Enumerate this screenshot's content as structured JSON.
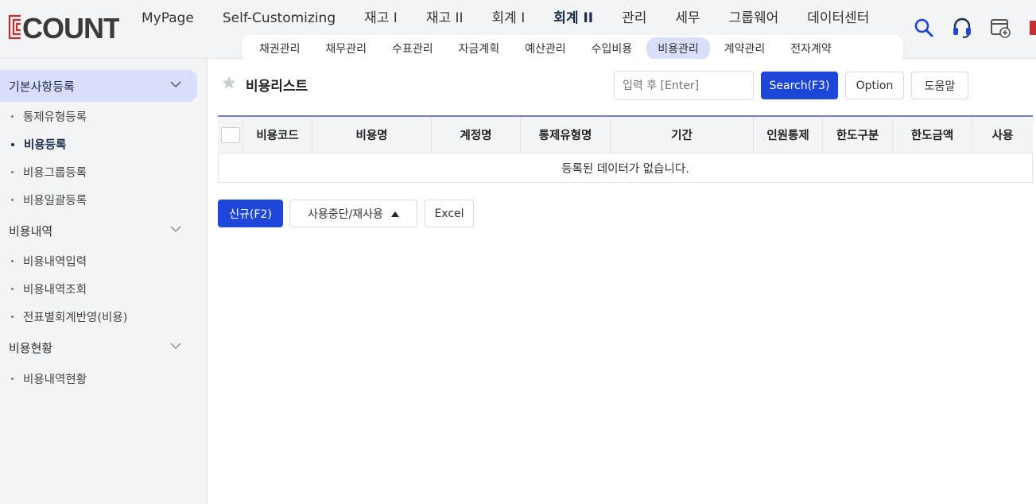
{
  "brand": {
    "logo_text": "ECOUNT",
    "logo_color": "#c62d2d"
  },
  "main_nav": [
    {
      "label": "MyPage",
      "active": false
    },
    {
      "label": "Self-Customizing",
      "active": false
    },
    {
      "label": "재고 I",
      "active": false
    },
    {
      "label": "재고 II",
      "active": false
    },
    {
      "label": "회계 I",
      "active": false
    },
    {
      "label": "회계 II",
      "active": true
    },
    {
      "label": "관리",
      "active": false
    },
    {
      "label": "세무",
      "active": false
    },
    {
      "label": "그룹웨어",
      "active": false
    },
    {
      "label": "데이터센터",
      "active": false
    }
  ],
  "header_icons": [
    "search-icon",
    "headset-icon",
    "add-window-icon"
  ],
  "sub_nav": [
    {
      "label": "채권관리",
      "active": false
    },
    {
      "label": "채무관리",
      "active": false
    },
    {
      "label": "수표관리",
      "active": false
    },
    {
      "label": "자금계획",
      "active": false
    },
    {
      "label": "예산관리",
      "active": false
    },
    {
      "label": "수입비용",
      "active": false
    },
    {
      "label": "비용관리",
      "active": true
    },
    {
      "label": "계약관리",
      "active": false
    },
    {
      "label": "전자계약",
      "active": false
    }
  ],
  "sidebar": {
    "groups": [
      {
        "label": "기본사항등록",
        "active": true,
        "items": [
          {
            "label": "통제유형등록",
            "active": false
          },
          {
            "label": "비용등록",
            "active": true
          },
          {
            "label": "비용그룹등록",
            "active": false
          },
          {
            "label": "비용일괄등록",
            "active": false
          }
        ]
      },
      {
        "label": "비용내역",
        "active": false,
        "items": [
          {
            "label": "비용내역입력",
            "active": false
          },
          {
            "label": "비용내역조회",
            "active": false
          },
          {
            "label": "전표별회계반영(비용)",
            "active": false
          }
        ]
      },
      {
        "label": "비용현황",
        "active": false,
        "items": [
          {
            "label": "비용내역현황",
            "active": false
          }
        ]
      }
    ]
  },
  "page": {
    "title": "비용리스트",
    "search_placeholder": "입력 후 [Enter]",
    "search_button": "Search(F3)",
    "option_button": "Option",
    "help_button": "도움말"
  },
  "table": {
    "columns": [
      "비용코드",
      "비용명",
      "계정명",
      "통제유형명",
      "기간",
      "인원통제",
      "한도구분",
      "한도금액",
      "사용"
    ],
    "empty_message": "등록된 데이터가 없습니다."
  },
  "actions": {
    "new_button": "신규(F2)",
    "toggle_button": "사용중단/재사용",
    "excel_button": "Excel"
  },
  "colors": {
    "primary": "#1d47d8",
    "active_bg": "#d9defa",
    "grid_top": "#6f7fd1"
  }
}
